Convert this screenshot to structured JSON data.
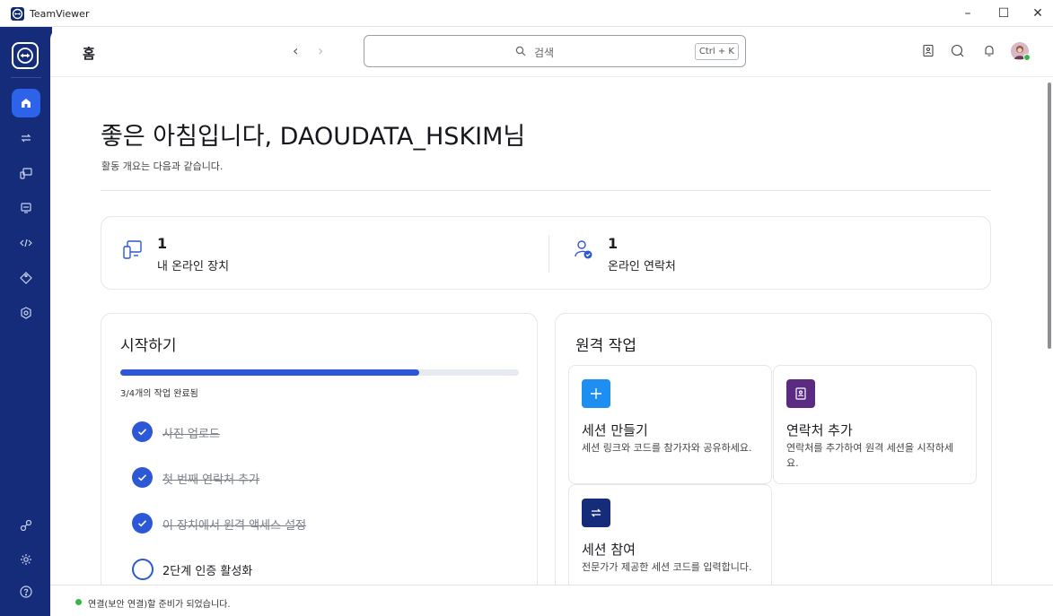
{
  "window": {
    "title": "TeamViewer",
    "controls": {
      "minimize": "–",
      "maximize": "☐",
      "close": "✕"
    }
  },
  "sidebar": {
    "items": [
      {
        "name": "home",
        "icon": "home-icon",
        "active": true
      },
      {
        "name": "connect",
        "icon": "arrows-exchange-icon"
      },
      {
        "name": "devices",
        "icon": "devices-icon"
      },
      {
        "name": "remote-management",
        "icon": "remote-screen-icon"
      },
      {
        "name": "developer",
        "icon": "code-icon"
      },
      {
        "name": "tags",
        "icon": "tag-icon"
      },
      {
        "name": "monitoring",
        "icon": "shield-eye-icon"
      }
    ],
    "bottom_items": [
      {
        "name": "integrations",
        "icon": "apps-icon"
      },
      {
        "name": "settings",
        "icon": "gear-icon"
      },
      {
        "name": "help",
        "icon": "help-icon"
      }
    ]
  },
  "header": {
    "title": "홈",
    "search": {
      "placeholder": "검색",
      "shortcut": "Ctrl + K"
    },
    "nav": {
      "back": "‹",
      "forward": "›"
    }
  },
  "greeting": {
    "title": "좋은 아침입니다, DAOUDATA_HSKIM님",
    "subtitle": "활동 개요는 다음과 같습니다."
  },
  "stats": [
    {
      "value": "1",
      "label": "내 온라인 장치",
      "icon": "device-icon"
    },
    {
      "value": "1",
      "label": "온라인 연락처",
      "icon": "contact-check-icon"
    }
  ],
  "getting_started": {
    "title": "시작하기",
    "progress": 0.75,
    "progress_label": "3/4개의 작업 완료됨",
    "tasks": [
      {
        "label": "사진 업로드",
        "done": true
      },
      {
        "label": "첫 번째 연락처 추가",
        "done": true
      },
      {
        "label": "이 장치에서 원격 액세스 설정",
        "done": true
      },
      {
        "label": "2단계 인증 활성화",
        "done": false
      }
    ]
  },
  "remote_work": {
    "title": "원격 작업",
    "tiles": [
      {
        "title": "세션 만들기",
        "desc": "세션 링크와 코드를 참가자와 공유하세요.",
        "icon": "plus-icon",
        "color": "#1f8ef1"
      },
      {
        "title": "연락처 추가",
        "desc": "연락처를 추가하여 원격 세션을 시작하세요.",
        "icon": "contact-book-icon",
        "color": "#5b2b82"
      },
      {
        "title": "세션 참여",
        "desc": "전문가가 제공한 세션 코드를 입력합니다.",
        "icon": "arrows-exchange-icon",
        "color": "#142c7a"
      }
    ]
  },
  "status": {
    "text": "연결(보안 연결)할 준비가 되었습니다.",
    "color": "#3ab54a"
  }
}
